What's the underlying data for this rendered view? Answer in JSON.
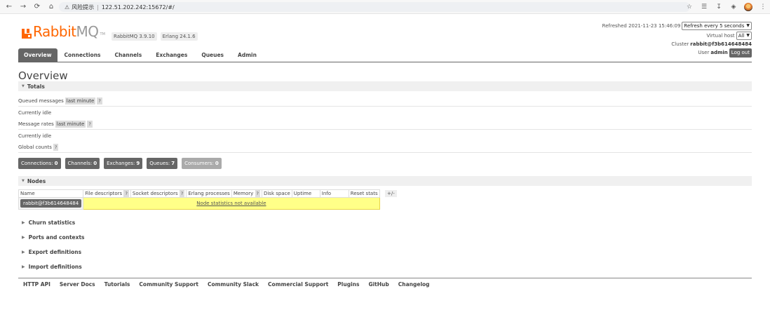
{
  "browser": {
    "security_label": "风险提示",
    "address_separator": "|",
    "url": "122.51.202.242:15672/#/"
  },
  "header": {
    "logo_rabbit": "Rabbit",
    "logo_mq": "MQ",
    "tm": "TM",
    "version_badges": [
      "RabbitMQ 3.9.10",
      "Erlang 24.1.6"
    ],
    "refreshed_label": "Refreshed 2021-11-23 15:46:09",
    "refresh_select": "Refresh every 5 seconds",
    "vhost_label": "Virtual host",
    "vhost_select": "All",
    "cluster_label": "Cluster",
    "cluster_name": "rabbit@f3b614648484",
    "user_label": "User",
    "user_name": "admin",
    "logout_label": "Log out"
  },
  "tabs": [
    "Overview",
    "Connections",
    "Channels",
    "Exchanges",
    "Queues",
    "Admin"
  ],
  "overview": {
    "title": "Overview",
    "totals_label": "Totals",
    "queued_messages_label": "Queued messages",
    "queued_messages_period": "last minute",
    "help": "?",
    "currently_idle_1": "Currently idle",
    "message_rates_label": "Message rates",
    "message_rates_period": "last minute",
    "currently_idle_2": "Currently idle",
    "global_counts_label": "Global counts"
  },
  "counts": {
    "connections_label": "Connections:",
    "connections": "0",
    "channels_label": "Channels:",
    "channels": "0",
    "exchanges_label": "Exchanges:",
    "exchanges": "9",
    "queues_label": "Queues:",
    "queues": "7",
    "consumers_label": "Consumers:",
    "consumers": "0"
  },
  "nodes": {
    "section_label": "Nodes",
    "columns": [
      "Name",
      "File descriptors",
      "Socket descriptors",
      "Erlang processes",
      "Memory",
      "Disk space",
      "Uptime",
      "Info",
      "Reset stats"
    ],
    "node_name": "rabbit@f3b614648484",
    "unavailable": "Node statistics not available",
    "plusminus": "+/-"
  },
  "collapsed_sections": [
    "Churn statistics",
    "Ports and contexts",
    "Export definitions",
    "Import definitions"
  ],
  "footer": [
    "HTTP API",
    "Server Docs",
    "Tutorials",
    "Community Support",
    "Community Slack",
    "Commercial Support",
    "Plugins",
    "GitHub",
    "Changelog"
  ],
  "colors": {
    "brand": "#ff6600",
    "tab_active": "#666666",
    "highlight": "#ffff88"
  }
}
